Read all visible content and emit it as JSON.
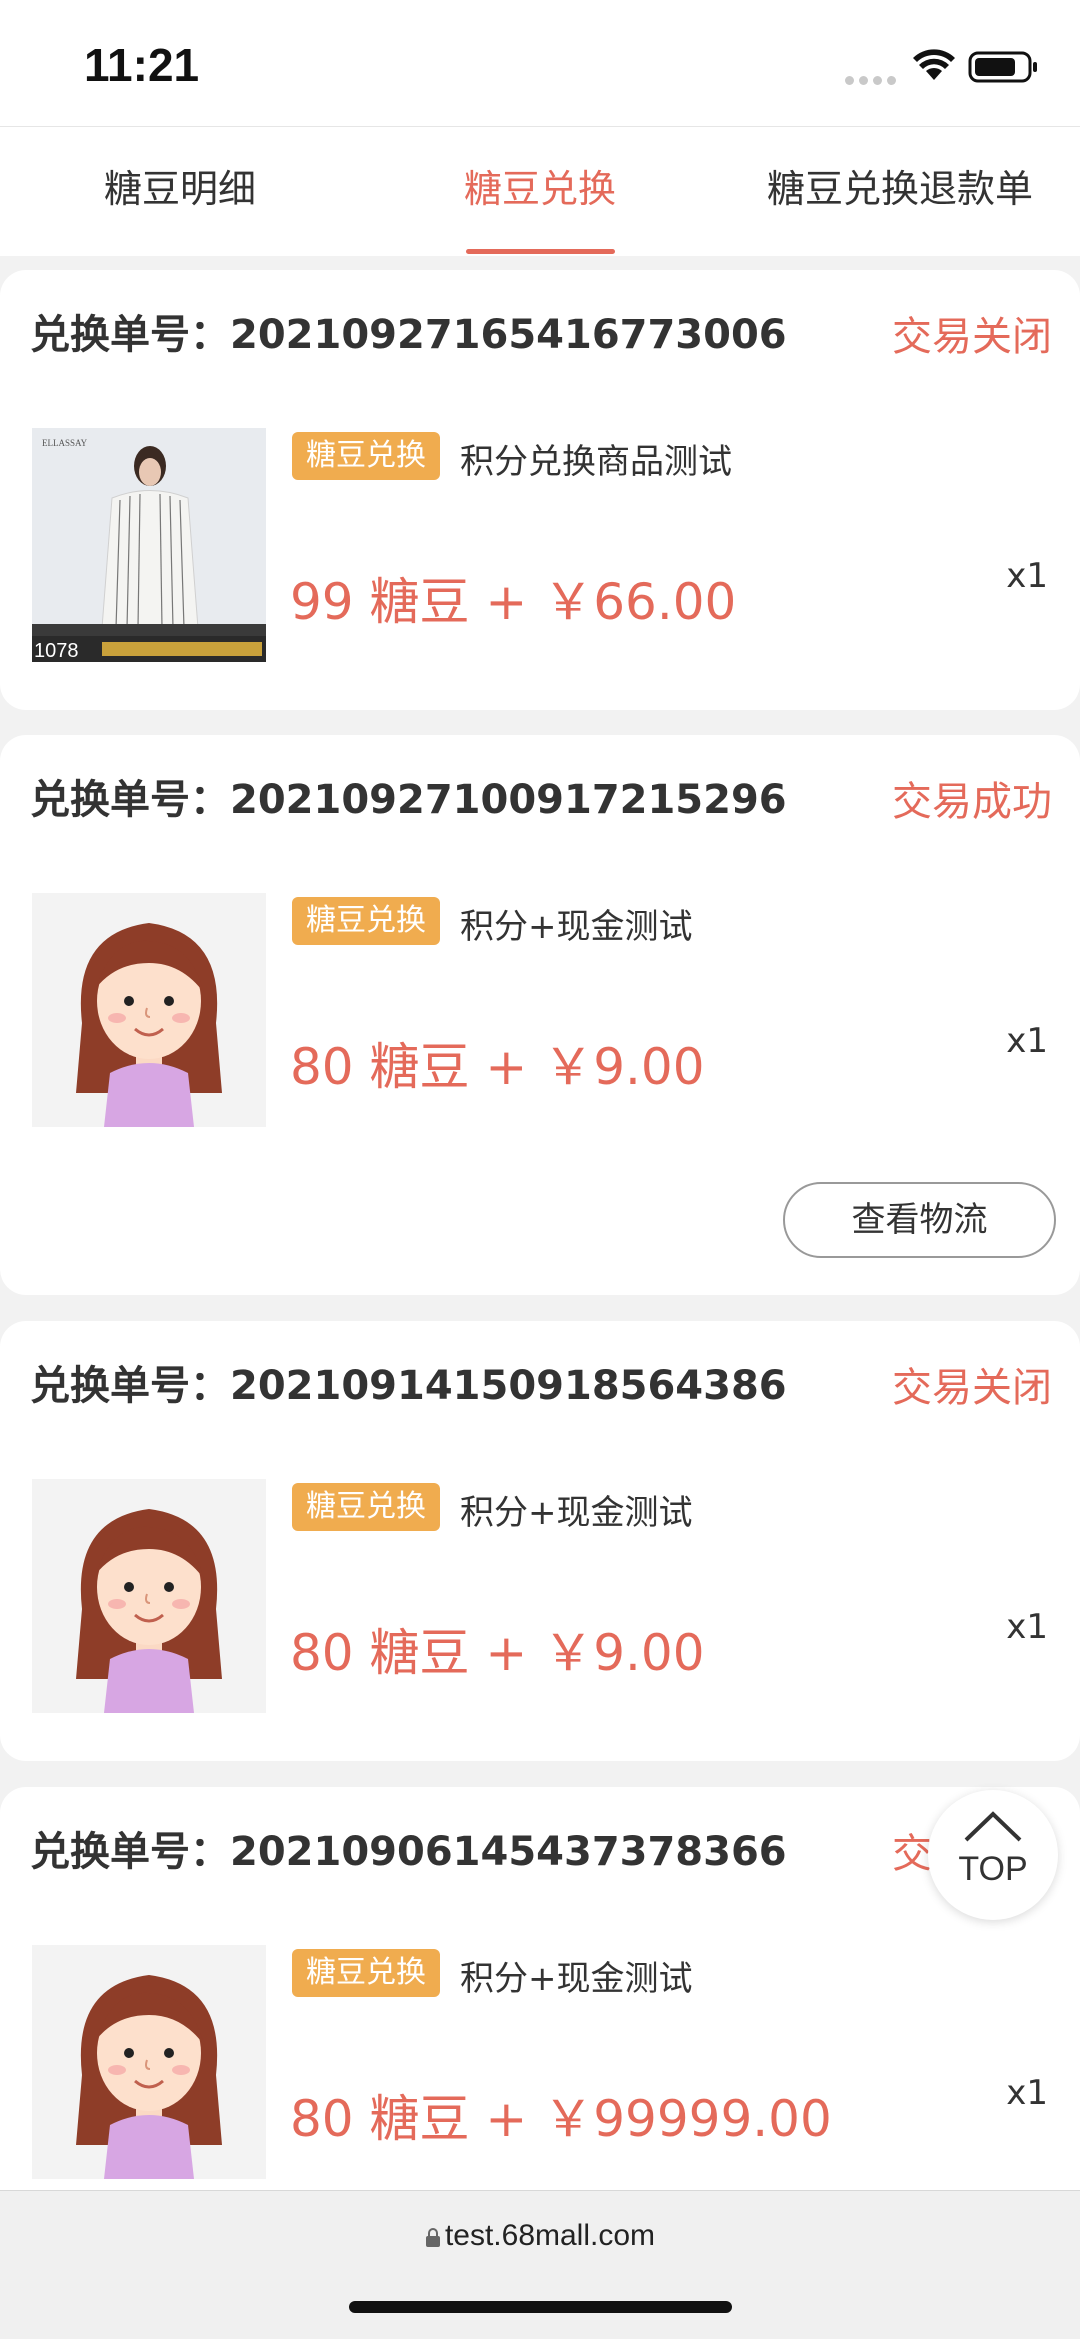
{
  "status_bar": {
    "time": "11:21"
  },
  "tabs": [
    {
      "label": "糖豆明细",
      "active": false
    },
    {
      "label": "糖豆兑换",
      "active": true
    },
    {
      "label": "糖豆兑换退款单",
      "active": false
    }
  ],
  "orders": [
    {
      "order_label": "兑换单号：20210927165416773006",
      "status": "交易关闭",
      "badge": "糖豆兑换",
      "product_name": "积分兑换商品测试",
      "price": "99 糖豆 + ￥66.00",
      "qty": "x1",
      "thumb": "clothing-photo",
      "thumb_text": "1078"
    },
    {
      "order_label": "兑换单号：20210927100917215296",
      "status": "交易成功",
      "badge": "糖豆兑换",
      "product_name": "积分+现金测试",
      "price": "80 糖豆 + ￥9.00",
      "qty": "x1",
      "thumb": "avatar-girl",
      "action": "查看物流"
    },
    {
      "order_label": "兑换单号：20210914150918564386",
      "status": "交易关闭",
      "badge": "糖豆兑换",
      "product_name": "积分+现金测试",
      "price": "80 糖豆 + ￥9.00",
      "qty": "x1",
      "thumb": "avatar-girl"
    },
    {
      "order_label": "兑换单号：20210906145437378366",
      "status": "交易关闭",
      "badge": "糖豆兑换",
      "product_name": "积分+现金测试",
      "price": "80 糖豆 + ￥99999.00",
      "qty": "x1",
      "thumb": "avatar-girl"
    }
  ],
  "top_button": {
    "label": "TOP"
  },
  "browser": {
    "url": "test.68mall.com"
  },
  "colors": {
    "accent": "#e46a5a",
    "badge": "#f0ac4f",
    "background": "#f2f2f2"
  }
}
